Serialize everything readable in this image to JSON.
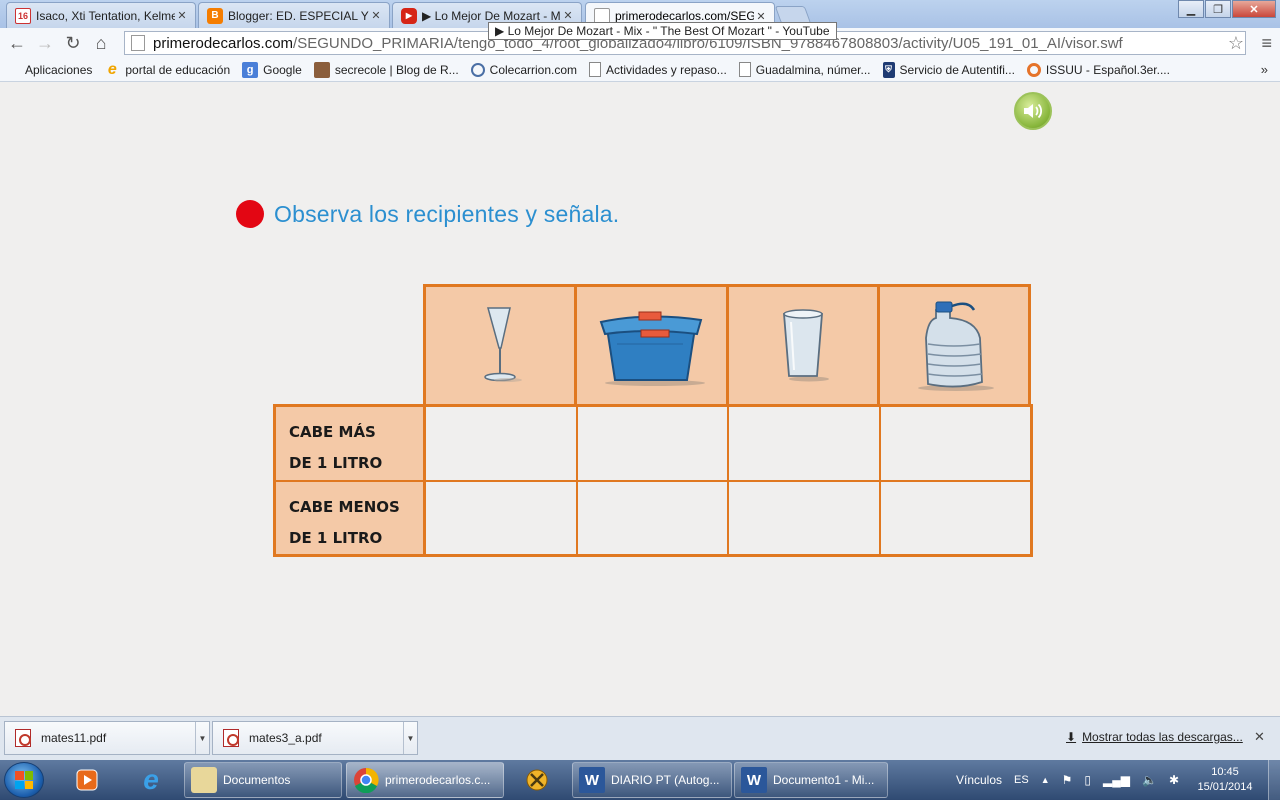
{
  "browser": {
    "tabs": [
      {
        "label": "Isaco, Xti Tentation, Kelme",
        "icon": "gmail-icon",
        "badge": "16"
      },
      {
        "label": "Blogger: ED. ESPECIAL Y A",
        "icon": "blogger-icon"
      },
      {
        "label": "▶ Lo Mejor De Mozart - M",
        "icon": "youtube-icon"
      },
      {
        "label": "primerodecarlos.com/SEG",
        "icon": "page-icon"
      }
    ],
    "tooltip": "▶ Lo Mejor De Mozart - Mix - \" The Best Of Mozart \" - YouTube",
    "url_host": "primerodecarlos.com",
    "url_path": "/SEGUNDO_PRIMARIA/tengo_todo_4/root_globalizado4/libro/6109/ISBN_9788467808803/activity/U05_191_01_AI/visor.swf",
    "bookmarks": [
      {
        "label": "Aplicaciones",
        "icon": "apps-grid-icon"
      },
      {
        "label": "portal de educación",
        "icon": "ie-e-icon"
      },
      {
        "label": "Google",
        "icon": "google-icon"
      },
      {
        "label": "secrecole | Blog de R...",
        "icon": "secrecole-icon"
      },
      {
        "label": "Colecarrion.com",
        "icon": "colecarrion-icon"
      },
      {
        "label": "Actividades y repaso...",
        "icon": "page-icon"
      },
      {
        "label": "Guadalmina, númer...",
        "icon": "page-icon"
      },
      {
        "label": "Servicio de Autentifi...",
        "icon": "shield-icon"
      },
      {
        "label": "ISSUU - Español.3er....",
        "icon": "issuu-icon"
      }
    ],
    "more_bookmarks": "»"
  },
  "activity": {
    "instruction": "Observa los recipientes y señala.",
    "containers": [
      {
        "name": "glass-cup-icon"
      },
      {
        "name": "bucket-icon"
      },
      {
        "name": "tumbler-glass-icon"
      },
      {
        "name": "water-jug-icon"
      }
    ],
    "rows": [
      {
        "line1": "CABE MÁS",
        "line2": "DE 1 LITRO"
      },
      {
        "line1": "CABE MENOS",
        "line2": "DE 1 LITRO"
      }
    ]
  },
  "downloads": {
    "items": [
      {
        "filename": "mates11.pdf"
      },
      {
        "filename": "mates3_a.pdf"
      }
    ],
    "show_all": "Mostrar todas las descargas..."
  },
  "taskbar": {
    "windows": [
      {
        "label": "Documentos",
        "icon": "explorer-icon"
      },
      {
        "label": "primerodecarlos.c...",
        "icon": "chrome-icon"
      },
      {
        "label": "DIARIO PT (Autog...",
        "icon": "word-icon"
      },
      {
        "label": "Documento1 - Mi...",
        "icon": "word-icon"
      }
    ],
    "tray_vinculos": "Vínculos",
    "tray_lang": "ES",
    "time": "10:45",
    "date": "15/01/2014"
  },
  "colors": {
    "accent_orange": "#e07820",
    "cell_peach": "#f4c9a7",
    "instruction_blue": "#2b8fd0",
    "bullet_red": "#e30613"
  }
}
